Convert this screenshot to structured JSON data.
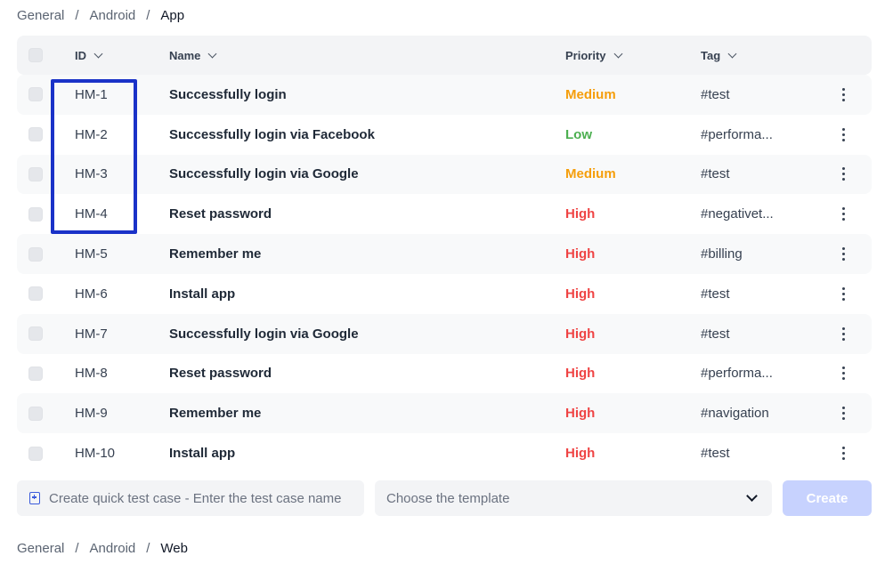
{
  "breadcrumb_top": {
    "items": [
      "General",
      "Android",
      "App"
    ],
    "separator": "/"
  },
  "table": {
    "headers": {
      "id": "ID",
      "name": "Name",
      "priority": "Priority",
      "tag": "Tag"
    },
    "rows": [
      {
        "id": "HM-1",
        "name": "Successfully login",
        "priority": "Medium",
        "tag": "#test"
      },
      {
        "id": "HM-2",
        "name": "Successfully login via Facebook",
        "priority": "Low",
        "tag": "#performa..."
      },
      {
        "id": "HM-3",
        "name": "Successfully login via Google",
        "priority": "Medium",
        "tag": "#test"
      },
      {
        "id": "HM-4",
        "name": "Reset password",
        "priority": "High",
        "tag": "#negativet..."
      },
      {
        "id": "HM-5",
        "name": "Remember me",
        "priority": "High",
        "tag": "#billing"
      },
      {
        "id": "HM-6",
        "name": "Install app",
        "priority": "High",
        "tag": "#test"
      },
      {
        "id": "HM-7",
        "name": "Successfully login via Google",
        "priority": "High",
        "tag": "#test"
      },
      {
        "id": "HM-8",
        "name": "Reset password",
        "priority": "High",
        "tag": "#performa..."
      },
      {
        "id": "HM-9",
        "name": "Remember me",
        "priority": "High",
        "tag": "#navigation"
      },
      {
        "id": "HM-10",
        "name": "Install app",
        "priority": "High",
        "tag": "#test"
      }
    ]
  },
  "priority_colors": {
    "Medium": "#f59e0b",
    "Low": "#4caf50",
    "High": "#ef4444"
  },
  "quick_create": {
    "placeholder": "Create quick test case - Enter the test case name",
    "icon": "file-plus-icon"
  },
  "template_select": {
    "label": "Choose the template"
  },
  "create_button": {
    "label": "Create"
  },
  "breadcrumb_bottom": {
    "items": [
      "General",
      "Android",
      "Web"
    ],
    "separator": "/"
  },
  "colors": {
    "highlight": "#1a32c8",
    "create_disabled": "#c7d2fe",
    "accent": "#3b5bdb"
  }
}
